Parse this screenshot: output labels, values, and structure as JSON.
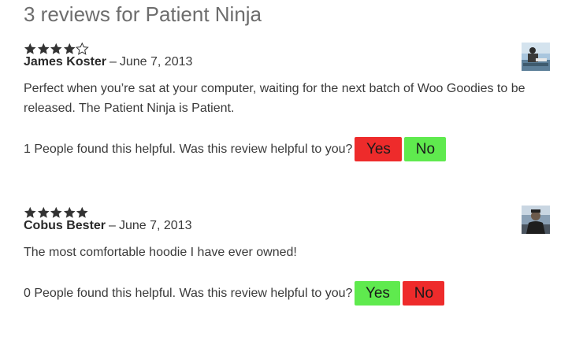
{
  "title": "3 reviews for Patient Ninja",
  "colors": {
    "star": "#333333",
    "red_button": "#ee2b2b",
    "green_button": "#5fea4e"
  },
  "reviews": [
    {
      "rating": 4,
      "author": "James Koster",
      "separator": "–",
      "date": "June 7, 2013",
      "text": "Perfect when you’re sat at your computer, waiting for the next batch of Woo Goodies to be released. The Patient Ninja is Patient.",
      "helpful_text": "1 People found this helpful. Was this review helpful to you?",
      "first_button": "Yes",
      "second_button": "No"
    },
    {
      "rating": 5,
      "author": "Cobus Bester",
      "separator": "–",
      "date": "June 7, 2013",
      "text": "The most comfortable hoodie I have ever owned!",
      "helpful_text": "0 People found this helpful. Was this review helpful to you?",
      "first_button": "Yes",
      "second_button": "No"
    }
  ]
}
